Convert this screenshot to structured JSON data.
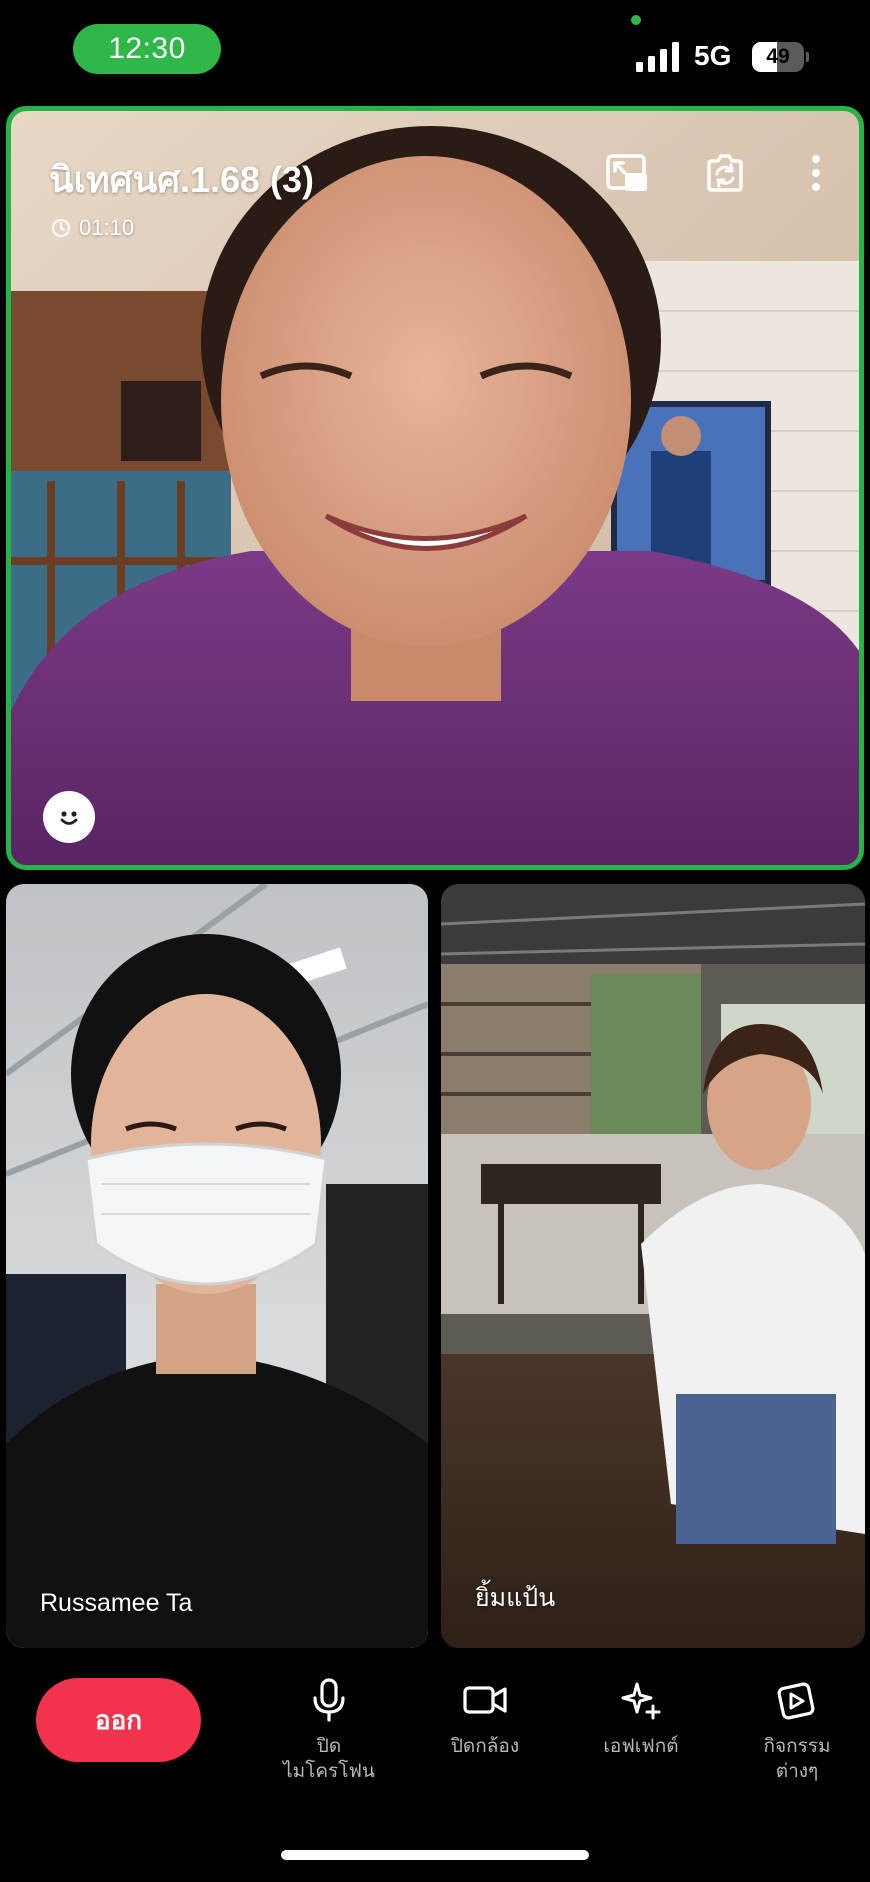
{
  "status_bar": {
    "time": "12:30",
    "network": "5G",
    "battery_level": "49",
    "battery_fraction": 0.49,
    "signal_bars": 4,
    "accent_color": "#2fb74a"
  },
  "call": {
    "group_name": "นิเทศนศ.1.68 (3)",
    "duration": "01:10",
    "active_speaker_border_color": "#25b445",
    "top_icons": [
      "picture-in-picture-icon",
      "switch-camera-icon",
      "more-options-icon"
    ],
    "participants": [
      {
        "name": "Russamee Ta"
      },
      {
        "name": "ยิ้มแป้น"
      }
    ]
  },
  "controls": {
    "leave_label": "ออก",
    "leave_color": "#f2334d",
    "mic_label": "ปิด\nไมโครโฟน",
    "camera_label": "ปิดกล้อง",
    "effects_label": "เอฟเฟกต์",
    "activities_label": "กิจกรรม\nต่างๆ"
  }
}
